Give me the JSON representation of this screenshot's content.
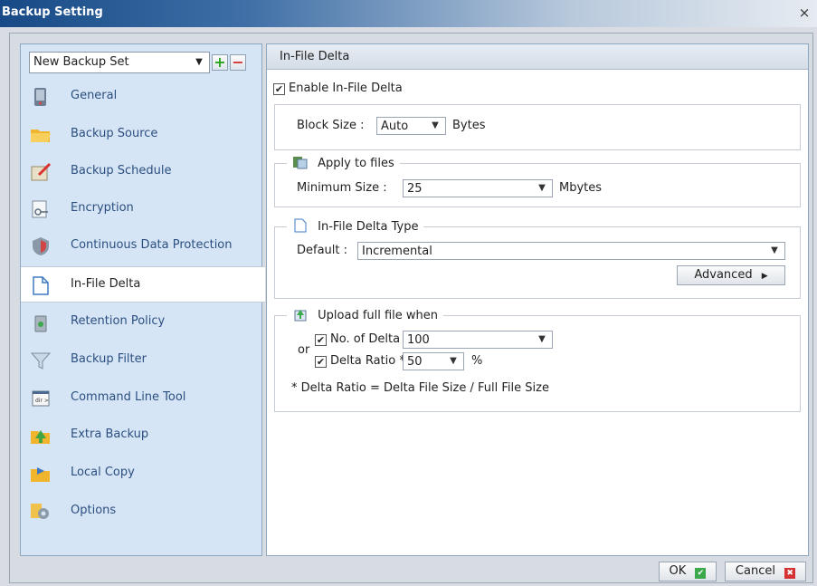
{
  "window": {
    "title": "Backup Setting",
    "close_glyph": "×"
  },
  "left": {
    "backup_set": "New Backup Set",
    "items": [
      {
        "label": "General",
        "icon": "disk-icon"
      },
      {
        "label": "Backup Source",
        "icon": "folder-icon"
      },
      {
        "label": "Backup Schedule",
        "icon": "calendar-icon"
      },
      {
        "label": "Encryption",
        "icon": "key-icon"
      },
      {
        "label": "Continuous Data Protection",
        "icon": "shield-icon"
      },
      {
        "label": "In-File Delta",
        "icon": "document-icon"
      },
      {
        "label": "Retention Policy",
        "icon": "recycle-bin-icon"
      },
      {
        "label": "Backup Filter",
        "icon": "funnel-icon"
      },
      {
        "label": "Command Line Tool",
        "icon": "terminal-icon"
      },
      {
        "label": "Extra Backup",
        "icon": "folder-arrow-icon"
      },
      {
        "label": "Local Copy",
        "icon": "folder-copy-icon"
      },
      {
        "label": "Options",
        "icon": "gears-icon"
      }
    ],
    "active_index": 5
  },
  "right": {
    "header": "In-File Delta",
    "enable_label": "Enable In-File Delta",
    "block_size": {
      "label": "Block Size :",
      "value": "Auto",
      "unit": "Bytes"
    },
    "apply": {
      "legend": "Apply to files",
      "min_label": "Minimum Size :",
      "min_value": "25",
      "unit": "Mbytes"
    },
    "type": {
      "legend": "In-File Delta Type",
      "default_label": "Default :",
      "value": "Incremental",
      "advanced": "Advanced"
    },
    "upload": {
      "legend": "Upload full file when",
      "or": "or",
      "delta_count_label": "No. of Delta >",
      "delta_count_value": "100",
      "ratio_label": "Delta Ratio * >",
      "ratio_value": "50",
      "ratio_unit": "%",
      "note": "* Delta Ratio = Delta File Size / Full File Size"
    }
  },
  "footer": {
    "ok": "OK",
    "cancel": "Cancel"
  }
}
